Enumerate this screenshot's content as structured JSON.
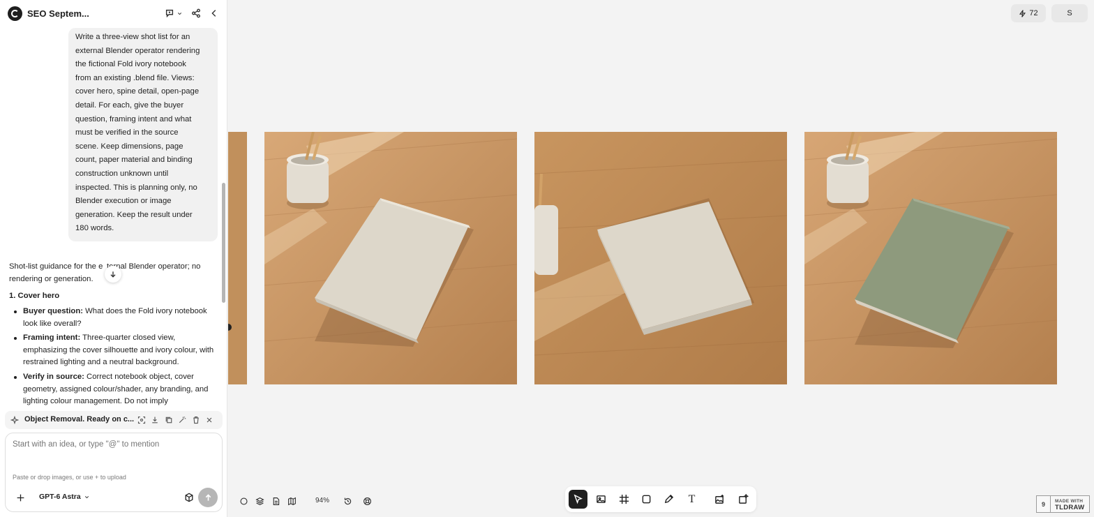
{
  "header": {
    "title": "SEO Septem...",
    "icons": [
      "logo-icon",
      "feedback-icon",
      "chevron-down-icon",
      "share-icon",
      "collapse-icon"
    ]
  },
  "user_message": {
    "lines": [
      "Write a three-view shot list for an",
      "external Blender operator rendering",
      "the fictional Fold ivory notebook",
      "from an existing .blend file. Views:",
      "cover hero, spine detail, open-page",
      "detail. For each, give the buyer",
      "question, framing intent and what",
      "must be verified in the source",
      "scene. Keep dimensions, page",
      "count, paper material and binding",
      "construction unknown until",
      "inspected. This is planning only, no",
      "Blender execution or image",
      "generation. Keep the result under",
      "180 words."
    ]
  },
  "assistant_message": {
    "intro_a": "Shot-list guidance for the e",
    "intro_b": "ternal Blender operator; no",
    "intro_c": "rendering or generation.",
    "section_title": "1. Cover hero",
    "bullets": [
      {
        "label": "Buyer question:",
        "text": " What does the Fold ivory notebook look like overall?"
      },
      {
        "label": "Framing intent:",
        "text": " Three-quarter closed view, emphasizing the cover silhouette and ivory colour, with restrained lighting and a neutral background."
      },
      {
        "label": "Verify in source:",
        "text": " Correct notebook object, cover geometry, assigned colour/shader, any branding, and lighting colour management. Do not imply"
      }
    ]
  },
  "task": {
    "label": "Object Removal. Ready on c...",
    "icons": [
      "sparkle-icon",
      "focus-icon",
      "download-icon",
      "copy-icon",
      "magic-wand-icon",
      "trash-icon",
      "close-icon"
    ]
  },
  "composer": {
    "placeholder": "Start with an idea, or type \"@\" to mention",
    "hint": "Paste or drop images, or use + to upload",
    "model": "GPT-6 Astra"
  },
  "topbar": {
    "credits": "72",
    "user_initial": "S"
  },
  "canvas": {
    "zoom": "94%",
    "images": [
      {
        "name": "partial-image",
        "cover": "#cfc8bb"
      },
      {
        "name": "ivory-notebook-with-pencil-cup",
        "cover": "#d9d3c6"
      },
      {
        "name": "ivory-notebook-centered",
        "cover": "#d8d2c5"
      },
      {
        "name": "green-notebook-with-pencil-cup",
        "cover": "#8e9a7d"
      }
    ]
  },
  "toolbar": {
    "tools": [
      "select-tool",
      "image-edit-tool",
      "frame-tool",
      "rectangle-tool",
      "pencil-tool",
      "text-tool",
      "image-generate-tool",
      "ai-tool"
    ],
    "text_tool_glyph": "T"
  },
  "watermark": {
    "small": "MADE WITH",
    "big": "TLDRAW"
  },
  "colors": {
    "canvas_bg": "#f3f3f3",
    "sidebar_bg": "#ffffff",
    "bubble_bg": "#f1f1f1",
    "active_tool": "#1f1f1f",
    "wood": "#c48f5c"
  }
}
